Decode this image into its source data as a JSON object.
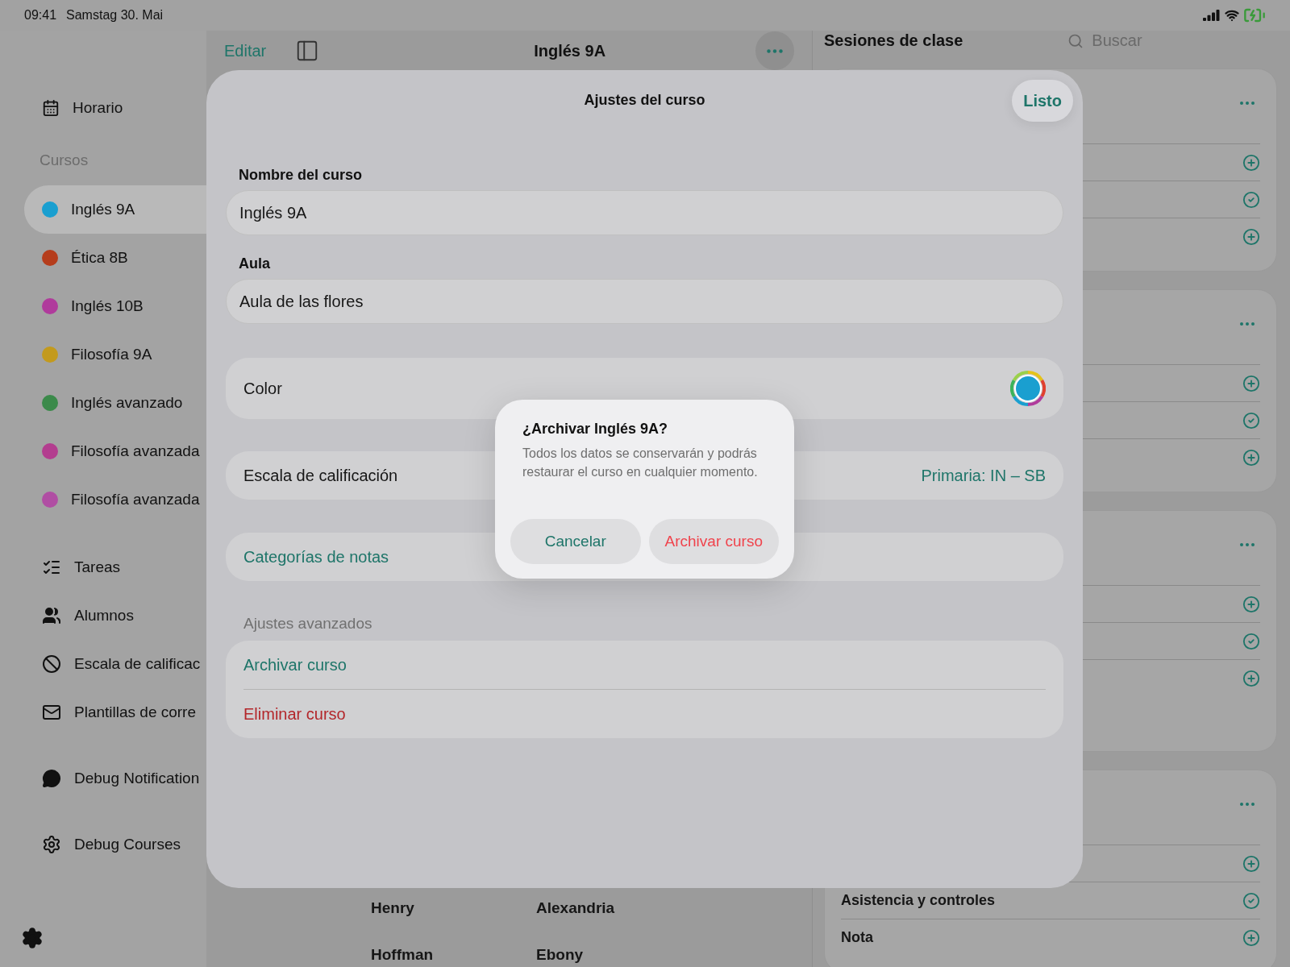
{
  "status_bar": {
    "time": "09:41",
    "date": "Samstag 30. Mai"
  },
  "sidebar": {
    "schedule": "Horario",
    "courses_heading": "Cursos",
    "courses": [
      {
        "label": "Inglés 9A",
        "color": "#1a9fd0",
        "selected": true
      },
      {
        "label": "Ética 8B",
        "color": "#b53d1c",
        "selected": false
      },
      {
        "label": "Inglés 10B",
        "color": "#b03b9c",
        "selected": false
      },
      {
        "label": "Filosofía 9A",
        "color": "#c39a1d",
        "selected": false
      },
      {
        "label": "Inglés avanzado",
        "color": "#3b8a4a",
        "selected": false
      },
      {
        "label": "Filosofía avanzada",
        "color": "#b33d8f",
        "selected": false
      },
      {
        "label": "Filosofía avanzada",
        "color": "#b04ea3",
        "selected": false
      }
    ],
    "tools": [
      "Tareas",
      "Alumnos",
      "Escala de calificac",
      "Plantillas de corre"
    ],
    "debug": [
      "Debug Notification",
      "Debug Courses"
    ]
  },
  "course_header": {
    "edit": "Editar",
    "title": "Inglés 9A"
  },
  "students": [
    {
      "column_1": "Henry",
      "column_2": "Alexandria"
    },
    {
      "column_1": "Hoffman",
      "column_2": "Ebony"
    }
  ],
  "sessions": {
    "title": "Sesiones de clase",
    "search": {
      "placeholder": "Buscar"
    },
    "cards": [
      {
        "rows": [
          {
            "kind": "add"
          },
          {
            "kind": "check"
          },
          {
            "kind": "add"
          }
        ]
      },
      {
        "rows": [
          {
            "kind": "add"
          },
          {
            "kind": "check"
          },
          {
            "kind": "add"
          }
        ]
      },
      {
        "rows": [
          {
            "kind": "add"
          },
          {
            "kind": "check"
          },
          {
            "kind": "add"
          }
        ]
      },
      {
        "rows": [
          {
            "kind": "add"
          },
          {
            "kind": "check",
            "label": "Asistencia y controles"
          },
          {
            "kind": "add",
            "label": "Nota"
          }
        ]
      }
    ]
  },
  "sheet": {
    "title": "Ajustes del curso",
    "done": "Listo",
    "name_label": "Nombre del curso",
    "name_value": "Inglés 9A",
    "room_label": "Aula",
    "room_value": "Aula de las flores",
    "color_label": "Color",
    "color": "#1a9fd0",
    "scale_label": "Escala de calificación",
    "scale_value": "Primaria: IN – SB",
    "categories": "Categorías de notas",
    "advanced_heading": "Ajustes avanzados",
    "archive": "Archivar curso",
    "delete": "Eliminar curso"
  },
  "alert": {
    "title": "¿Archivar Inglés 9A?",
    "message": "Todos los datos se conservarán y podrás restaurar el curso en cualquier momento.",
    "cancel": "Cancelar",
    "confirm": "Archivar curso"
  }
}
